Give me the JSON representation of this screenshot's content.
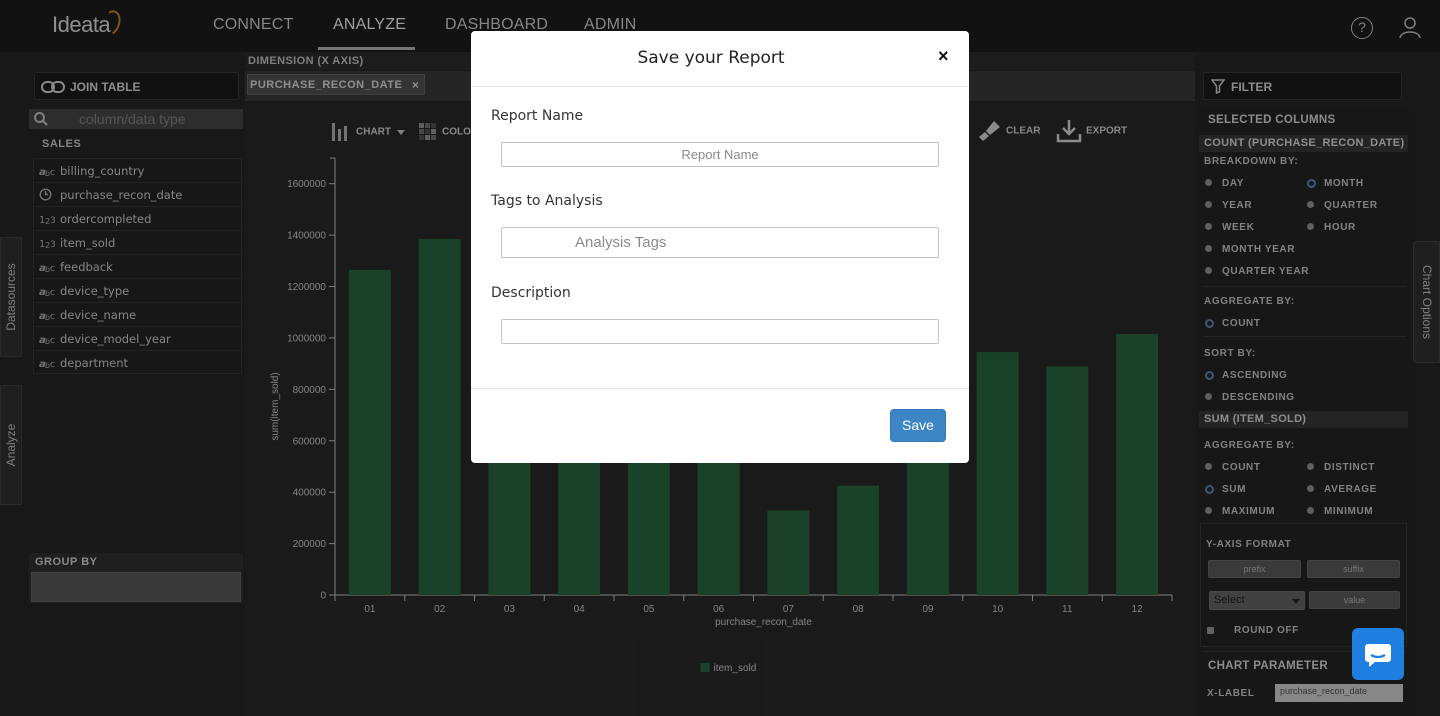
{
  "app": {
    "logo": "Ideata"
  },
  "nav": {
    "connect": "CONNECT",
    "analyze": "ANALYZE",
    "dashboard": "DASHBOARD",
    "admin": "ADMIN",
    "help": "?"
  },
  "side_tabs": {
    "datasources": "Datasources",
    "analyze": "Analyze"
  },
  "left": {
    "join_table": "JOIN TABLE",
    "search_placeholder": "column/data type",
    "group_label": "SALES",
    "fields": [
      {
        "name": "billing_country",
        "icon": "abc"
      },
      {
        "name": "purchase_recon_date",
        "icon": "clock"
      },
      {
        "name": "ordercompleted",
        "icon": "123"
      },
      {
        "name": "item_sold",
        "icon": "123"
      },
      {
        "name": "feedback",
        "icon": "abc"
      },
      {
        "name": "device_type",
        "icon": "abc"
      },
      {
        "name": "device_name",
        "icon": "abc"
      },
      {
        "name": "device_model_year",
        "icon": "abc"
      },
      {
        "name": "department",
        "icon": "abc"
      }
    ],
    "group_by": "GROUP BY"
  },
  "dimension": {
    "header": "DIMENSION (X AXIS)",
    "chip": "PURCHASE_RECON_DATE",
    "chip_close": "×"
  },
  "toolbar": {
    "chart": "CHART",
    "color": "COLOR",
    "clear": "CLEAR",
    "export": "EXPORT"
  },
  "chart_data": {
    "type": "bar",
    "categories": [
      "01",
      "02",
      "03",
      "04",
      "05",
      "06",
      "07",
      "08",
      "09",
      "10",
      "11",
      "12"
    ],
    "series": [
      {
        "name": "item_sold",
        "color": "#2a6a44",
        "values": [
          1265000,
          1385000,
          550000,
          550000,
          550000,
          550000,
          330000,
          425000,
          550000,
          945000,
          890000,
          1015000
        ]
      }
    ],
    "xlabel": "purchase_recon_date",
    "ylabel": "sum(item_sold)",
    "ylim": [
      0,
      1700000
    ],
    "yticks": [
      0,
      200000,
      400000,
      600000,
      800000,
      1000000,
      1200000,
      1400000,
      1600000
    ],
    "legend": "bottom-center",
    "grid": false
  },
  "right": {
    "filter": "FILTER",
    "selected_columns": "SELECTED COLUMNS",
    "col1_title": "COUNT (PURCHASE_RECON_DATE)",
    "breakdown_by": "BREAKDOWN BY:",
    "breakdown": {
      "day": "DAY",
      "month": "MONTH",
      "year": "YEAR",
      "quarter": "QUARTER",
      "week": "WEEK",
      "hour": "HOUR",
      "month_year": "MONTH YEAR",
      "quarter_year": "QUARTER YEAR"
    },
    "aggregate_by": "AGGREGATE BY:",
    "count": "COUNT",
    "sort_by": "SORT BY:",
    "ascending": "ASCENDING",
    "descending": "DESCENDING",
    "col2_title": "SUM (ITEM_SOLD)",
    "agg2": {
      "count": "COUNT",
      "distinct": "DISTINCT",
      "sum": "SUM",
      "average": "AVERAGE",
      "maximum": "MAXIMUM",
      "minimum": "MINIMUM"
    },
    "yaxis_format": "Y-AXIS FORMAT",
    "prefix": "prefix",
    "suffix": "suffix",
    "select": "Select",
    "value": "value",
    "round_off": "ROUND OFF",
    "chart_parameter": "CHART PARAMETER",
    "x_label": "X-LABEL",
    "x_label_value": "purchase_recon_date",
    "chart_options": "Chart Options"
  },
  "modal": {
    "title": "Save your Report",
    "close": "×",
    "report_name_label": "Report Name",
    "report_name_placeholder": "Report Name",
    "tags_label": "Tags to Analysis",
    "tags_placeholder": "Analysis Tags",
    "description_label": "Description",
    "save": "Save"
  }
}
